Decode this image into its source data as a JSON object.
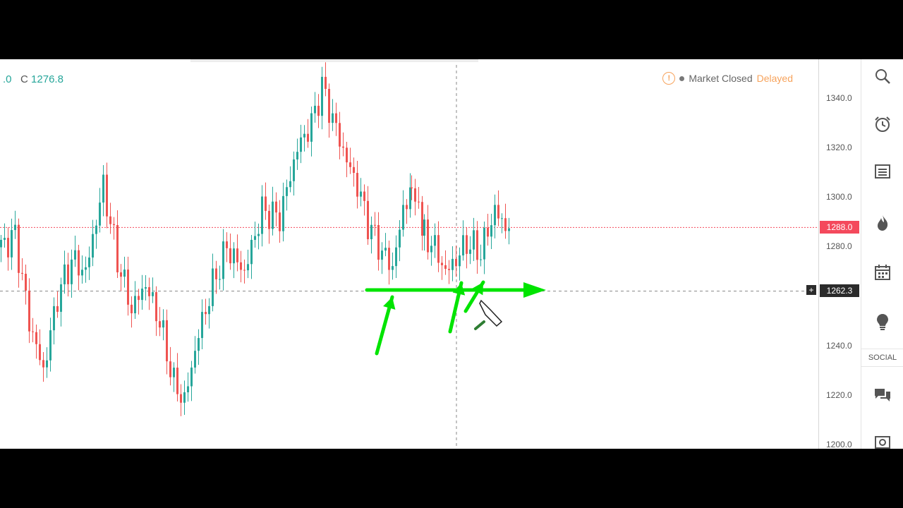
{
  "ohlc": {
    "prefix": ".0",
    "close_label": "C",
    "close_value": "1276.8"
  },
  "status": {
    "icon": "warning-icon",
    "market_text": "Market Closed",
    "delayed_text": "Delayed"
  },
  "price_axis": {
    "ticks": [
      "1340.0",
      "1320.0",
      "1300.0",
      "1280.0",
      "1240.0",
      "1220.0",
      "1200.0"
    ]
  },
  "last_price": {
    "label": "1288.0",
    "value": 1288.0,
    "color": "#f4495c"
  },
  "crosshair": {
    "label": "1262.3",
    "value": 1262.3
  },
  "drawings": {
    "color": "#00e400",
    "description_lines": [
      "support-line",
      "arrows"
    ]
  },
  "colors": {
    "up": "#26a69a",
    "down": "#ef5350"
  },
  "toolbar": {
    "items": [
      {
        "name": "search-icon"
      },
      {
        "name": "alarm-clock-icon"
      },
      {
        "name": "list-icon"
      },
      {
        "name": "fire-icon"
      },
      {
        "name": "calendar-icon"
      },
      {
        "name": "lightbulb-icon"
      },
      {
        "name": "chat-icon"
      },
      {
        "name": "screenshot-icon"
      }
    ],
    "social_label": "SOCIAL"
  }
}
